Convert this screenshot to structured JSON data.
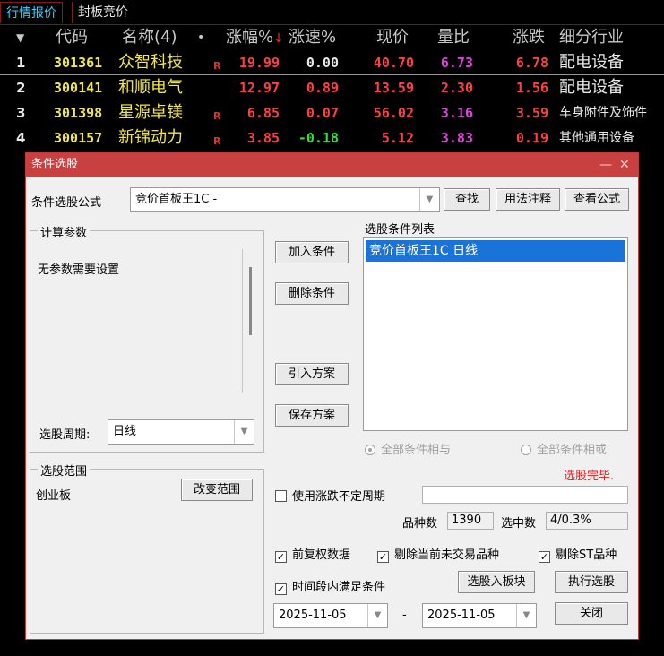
{
  "tabs": [
    "行情报价",
    "封板竞价"
  ],
  "table": {
    "headers": {
      "code": "代码",
      "name": "名称(4)",
      "dot": "•",
      "pct": "涨幅%",
      "sort_icon": "↓",
      "speed": "涨速%",
      "price": "现价",
      "volratio": "量比",
      "change": "涨跌",
      "industry": "细分行业"
    },
    "rows": [
      {
        "idx": "1",
        "code": "301361",
        "name": "众智科技",
        "flag": "R",
        "pct": "19.99",
        "speed": "0.00",
        "price": "40.70",
        "volratio": "6.73",
        "change": "6.78",
        "industry": "配电设备"
      },
      {
        "idx": "2",
        "code": "300141",
        "name": "和顺电气",
        "flag": "",
        "pct": "12.97",
        "speed": "0.89",
        "price": "13.59",
        "volratio": "2.30",
        "change": "1.56",
        "industry": "配电设备"
      },
      {
        "idx": "3",
        "code": "301398",
        "name": "星源卓镁",
        "flag": "R",
        "pct": "6.85",
        "speed": "0.07",
        "price": "56.02",
        "volratio": "3.16",
        "change": "3.59",
        "industry": "车身附件及饰件"
      },
      {
        "idx": "4",
        "code": "300157",
        "name": "新锦动力",
        "flag": "R",
        "pct": "3.85",
        "speed": "-0.18",
        "price": "5.12",
        "volratio": "3.83",
        "change": "0.19",
        "industry": "其他通用设备"
      }
    ],
    "colors": {
      "speed": [
        "#e8e8e8",
        "#ff4040",
        "#ff4040",
        "#30e040"
      ],
      "volratio": [
        "#e040e0",
        "#ff4040",
        "#e040e0",
        "#e040e0"
      ]
    }
  },
  "dialog": {
    "title": "条件选股",
    "formula_label": "条件选股公式",
    "formula_value": "竞价首板王1C  -",
    "find_btn": "查找",
    "usage_btn": "用法注释",
    "view_btn": "查看公式",
    "params_group": "计算参数",
    "params_text": "无参数需要设置",
    "add_btn": "加入条件",
    "del_btn": "删除条件",
    "import_btn": "引入方案",
    "save_btn": "保存方案",
    "list_label": "选股条件列表",
    "list_items": [
      "竞价首板王1C  日线"
    ],
    "period_label": "选股周期:",
    "period_value": "日线",
    "radio_and": "全部条件相与",
    "radio_or": "全部条件相或",
    "status": "选股完毕.",
    "range_group": "选股范围",
    "range_value": "创业板",
    "change_range_btn": "改变范围",
    "use_period": "使用涨跌不定周期",
    "count_label": "品种数",
    "count_value": "1390",
    "hit_label": "选中数",
    "hit_value": "4/0.3%",
    "cb_fq": "前复权数据",
    "cb_notrade": "剔除当前未交易品种",
    "cb_st": "剔除ST品种",
    "cb_time": "时间段内满足条件",
    "to_block_btn": "选股入板块",
    "run_btn": "执行选股",
    "date_from": "2025-11-05",
    "dash": "-",
    "date_to": "2025-11-05",
    "close_btn": "关闭",
    "check": "✓",
    "minimize": "—",
    "close_x": "✕"
  }
}
